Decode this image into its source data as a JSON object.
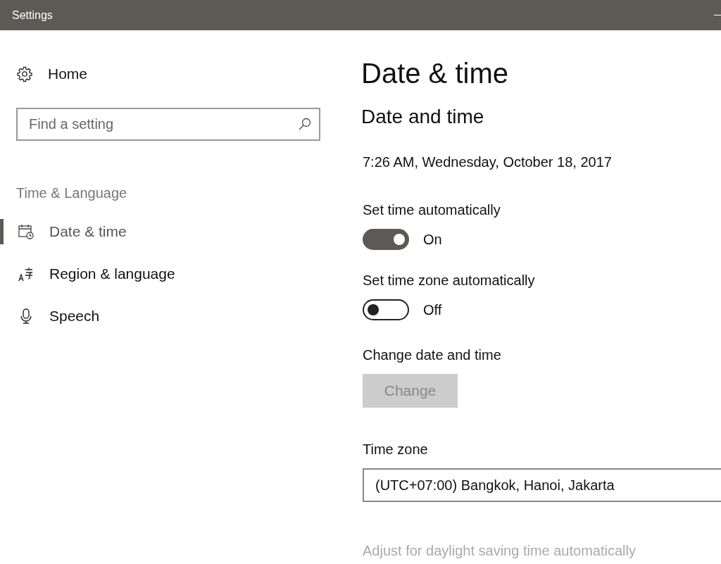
{
  "window": {
    "title": "Settings"
  },
  "sidebar": {
    "home": "Home",
    "search": {
      "placeholder": "Find a setting"
    },
    "section": "Time & Language",
    "items": [
      {
        "label": "Date & time",
        "selected": true
      },
      {
        "label": "Region & language",
        "selected": false
      },
      {
        "label": "Speech",
        "selected": false
      }
    ]
  },
  "page": {
    "title": "Date & time",
    "heading": "Date and time",
    "current": "7:26 AM, Wednesday, October 18, 2017",
    "toggles": [
      {
        "label": "Set time automatically",
        "on": true,
        "state_text": "On"
      },
      {
        "label": "Set time zone automatically",
        "on": false,
        "state_text": "Off"
      }
    ],
    "change": {
      "label": "Change date and time",
      "button": "Change",
      "disabled": true
    },
    "time_zone": {
      "label": "Time zone",
      "value": "(UTC+07:00) Bangkok, Hanoi, Jakarta"
    },
    "daylight": {
      "label": "Adjust for daylight saving time automatically",
      "disabled": true
    }
  }
}
